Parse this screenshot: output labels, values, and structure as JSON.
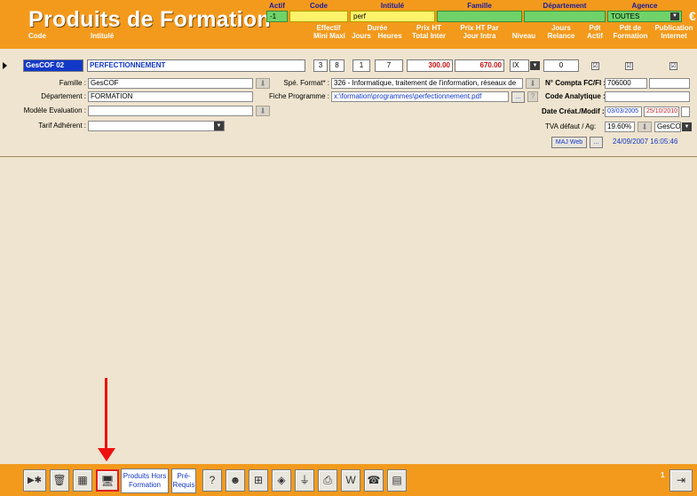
{
  "header": {
    "title": "Produits de Formation",
    "filters": {
      "actif": {
        "label": "Actif",
        "value": "-1"
      },
      "code": {
        "label": "Code",
        "value": ""
      },
      "intitule": {
        "label": "Intitulé",
        "value": "perf"
      },
      "famille": {
        "label": "Famille",
        "value": ""
      },
      "departement": {
        "label": "Département",
        "value": ""
      },
      "agence": {
        "label": "Agence",
        "value": "TOUTES"
      }
    },
    "columns": {
      "code": "Code",
      "intitule": "Intitulé",
      "effectif_top": "Effectif",
      "effectif_mini": "Mini",
      "effectif_maxi": "Maxi",
      "duree_top": "Durée",
      "duree_jours": "Jours",
      "duree_heures": "Heures",
      "prix_ht_top": "Prix HT",
      "prix_ht_bottom": "Total Inter",
      "prix_par_top": "Prix HT Par",
      "prix_par_bottom": "Jour Intra",
      "niveau": "Niveau",
      "jours_top": "Jours",
      "jours_bottom": "Relance",
      "pdt_top": "Pdt",
      "pdt_bottom": "Actif",
      "pdt_formation_top": "Pdt de",
      "pdt_formation_bottom": "Formation",
      "publication_top": "Publication",
      "publication_bottom": "Internet"
    }
  },
  "row": {
    "code": "GesCOF 02",
    "intitule": "PERFECTIONNEMENT",
    "mini": "3",
    "maxi": "8",
    "jours": "1",
    "heures": "7",
    "prix_total": "300.00",
    "prix_jour": "670.00",
    "niveau": "IX",
    "relance": "0",
    "pdt_actif": "☑",
    "pdt_formation": "☑",
    "publication": "☑"
  },
  "form": {
    "famille_label": "Famille :",
    "famille_value": "GesCOF",
    "departement_label": "Département :",
    "departement_value": "FORMATION",
    "modele_label": "Modèle Evaluation :",
    "modele_value": "",
    "tarif_label": "Tarif Adhérent :",
    "tarif_value": "",
    "spe_label": "Spé. Format* :",
    "spe_value": "326 - Informatique, traitement de l'information, réseaux de",
    "fiche_label": "Fiche Programme :",
    "fiche_value": "x:\\formation\\programmes\\perfectionnement.pdf",
    "compta_label": "N° Compta FC/FI :",
    "compta_value": "706000",
    "analytique_label": "Code Analytique :",
    "analytique_value": "",
    "date_label": "Date Créat./Modif :",
    "date_creat": "03/03/2005",
    "date_modif": "25/10/2010",
    "tva_label": "TVA défaut / Ag:",
    "tva_value": "19.60%",
    "tva_ag_value": "GesCO",
    "maj_web_label": "MAJ Web",
    "ellipsis": "...",
    "question": "?",
    "timestamp": "24/09/2007 16:05:46"
  },
  "toolbar": {
    "produits_hors_formation": "Produits Hors Formation",
    "pre_requis": "Pré-Requis",
    "page_num": "1"
  },
  "colors": {
    "header_orange": "#f39a1c",
    "background": "#efe4cf",
    "filter_green": "#6fd36a",
    "selection_blue": "#1238c8",
    "price_red": "#d01010",
    "annotation_red": "#ee1010"
  }
}
